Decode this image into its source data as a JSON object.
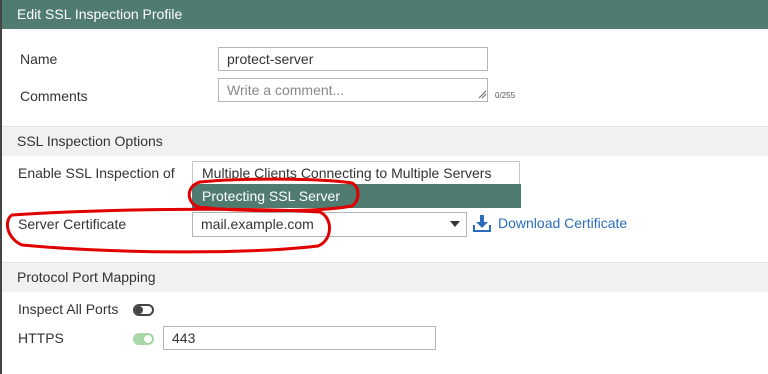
{
  "header": {
    "title": "Edit SSL Inspection Profile"
  },
  "form": {
    "name_label": "Name",
    "name_value": "protect-server",
    "comments_label": "Comments",
    "comments_placeholder": "Write a comment...",
    "comments_counter": "0/255"
  },
  "ssl_options": {
    "section_title": "SSL Inspection Options",
    "enable_label": "Enable SSL Inspection of",
    "option_multiple": "Multiple Clients Connecting to Multiple Servers",
    "option_protecting": "Protecting SSL Server",
    "selected_option": "Protecting SSL Server",
    "server_cert_label": "Server Certificate",
    "server_cert_value": "mail.example.com",
    "download_label": "Download Certificate"
  },
  "port_mapping": {
    "section_title": "Protocol Port Mapping",
    "inspect_all_label": "Inspect All Ports",
    "inspect_all_enabled": false,
    "https_label": "HTTPS",
    "https_enabled": true,
    "https_port": "443"
  },
  "colors": {
    "header_bg": "#4f7b70",
    "selected_bg": "#4f7b70",
    "link": "#2a6ebb",
    "annotation_red": "#e00000"
  }
}
